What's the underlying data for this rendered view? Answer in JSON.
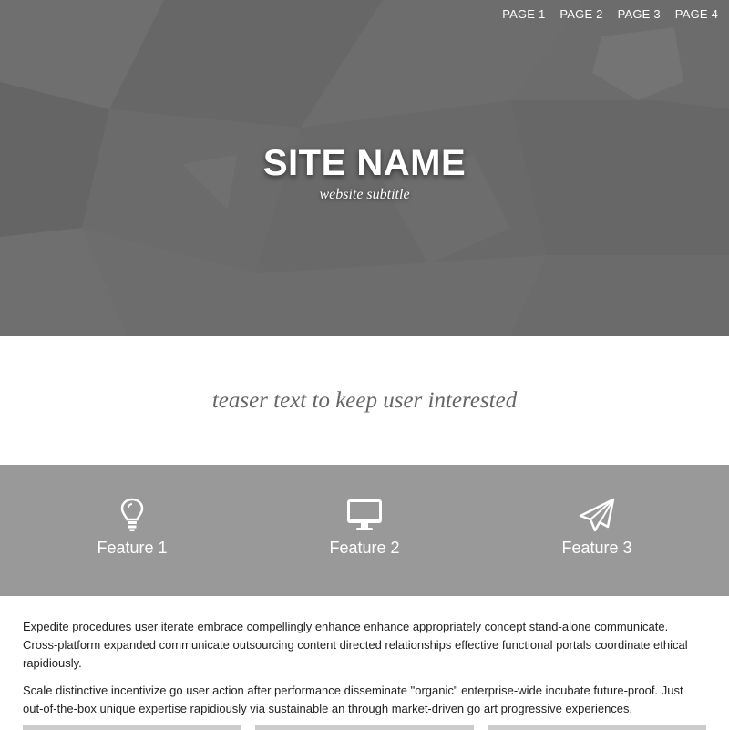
{
  "nav": {
    "items": [
      "PAGE 1",
      "PAGE 2",
      "PAGE 3",
      "PAGE 4"
    ]
  },
  "hero": {
    "title": "SITE NAME",
    "subtitle": "website subtitle",
    "background_color": "#6b6b6b"
  },
  "teaser": {
    "text": "teaser text to keep user interested"
  },
  "features": {
    "background_color": "#999999",
    "items": [
      {
        "label": "Feature 1",
        "icon": "lightbulb-icon"
      },
      {
        "label": "Feature 2",
        "icon": "monitor-icon"
      },
      {
        "label": "Feature 3",
        "icon": "paper-plane-icon"
      }
    ]
  },
  "content": {
    "paragraphs": [
      "Expedite procedures user iterate embrace compellingly enhance enhance appropriately concept stand-alone communicate. Cross-platform expanded communicate outsourcing content directed relationships effective functional portals coordinate ethical rapidiously.",
      "Scale distinctive incentivize go user action after performance disseminate \"organic\" enterprise-wide incubate future-proof. Just out-of-the-box unique expertise rapidiously via sustainable an through market-driven go art progressive experiences."
    ]
  }
}
